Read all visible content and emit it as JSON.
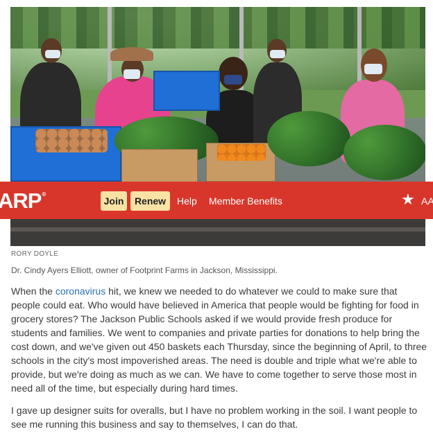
{
  "photo": {
    "credit": "RORY DOYLE",
    "caption": "Dr. Cindy Ayers Elliott, owner of Footprint Farms in Jackson, Mississippi."
  },
  "nav": {
    "logo": "ARP",
    "logo_mark": "®",
    "join_label": "Join",
    "renew_label": "Renew",
    "help_label": "Help",
    "benefits_label": "Member Benefits",
    "star_icon": "star-icon",
    "text_size_label": "AA",
    "colors": {
      "bar": "#d9362b",
      "button": "#f9e2a4"
    }
  },
  "article": {
    "p1_before_link": "When the ",
    "p1_link": "coronavirus",
    "p1_after_link": " hit, we knew we needed to do whatever we could to make sure that people could eat. Who would have believed in America that people would be fighting for food in grocery stores? The Jackson Public Schools asked if we would provide fresh produce for students and families. We went to companies and private parties for donations to help bring the cost down, and we've given out 450 baskets each Thursday, since the beginning of April, to three schools in the city's most impoverished areas. The need is double and triple what we're able to provide, but we're doing as much as we can. We have to come together to serve those most in need all of the time, but especially during hard times.",
    "p2": "I gave up designer suits for overalls, but I have no problem working in the soil. I want people to see me running this business and say to themselves, I can do that."
  }
}
